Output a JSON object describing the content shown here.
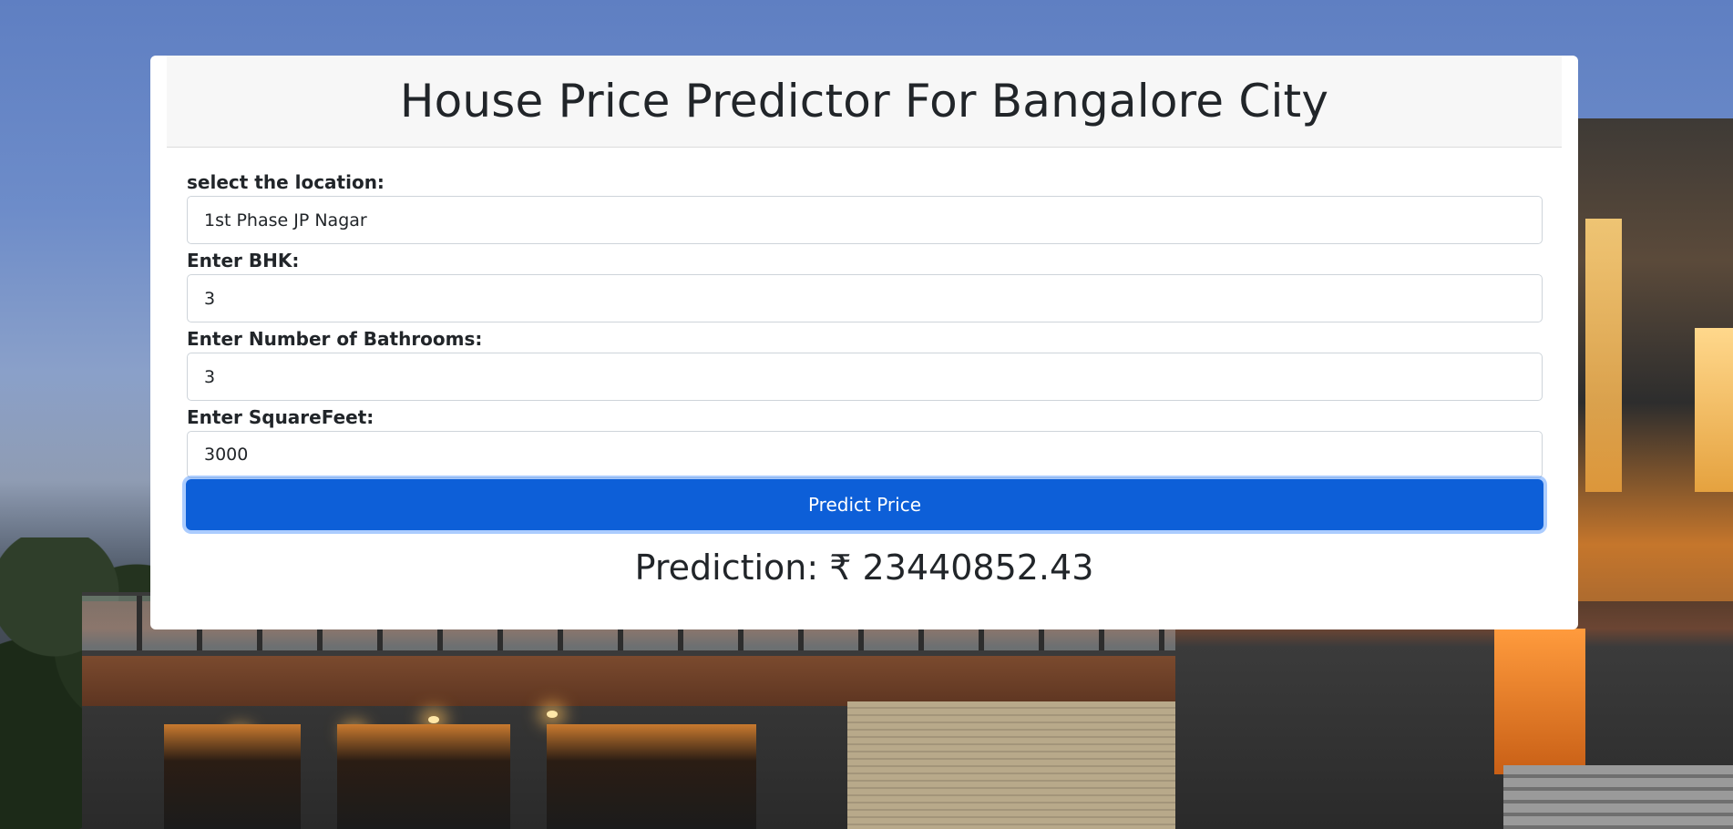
{
  "page": {
    "title": "House Price Predictor For Bangalore City"
  },
  "form": {
    "location": {
      "label": "select the location:",
      "value": "1st Phase JP Nagar"
    },
    "bhk": {
      "label": "Enter BHK:",
      "value": "3"
    },
    "bathrooms": {
      "label": "Enter Number of Bathrooms:",
      "value": "3"
    },
    "sqft": {
      "label": "Enter SquareFeet:",
      "value": "3000"
    },
    "submit_label": "Predict Price"
  },
  "result": {
    "text": "Prediction: ₹ 23440852.43"
  },
  "colors": {
    "button": "#0d5fd8",
    "header_bg": "#f7f7f7",
    "card_bg": "#ffffff"
  }
}
